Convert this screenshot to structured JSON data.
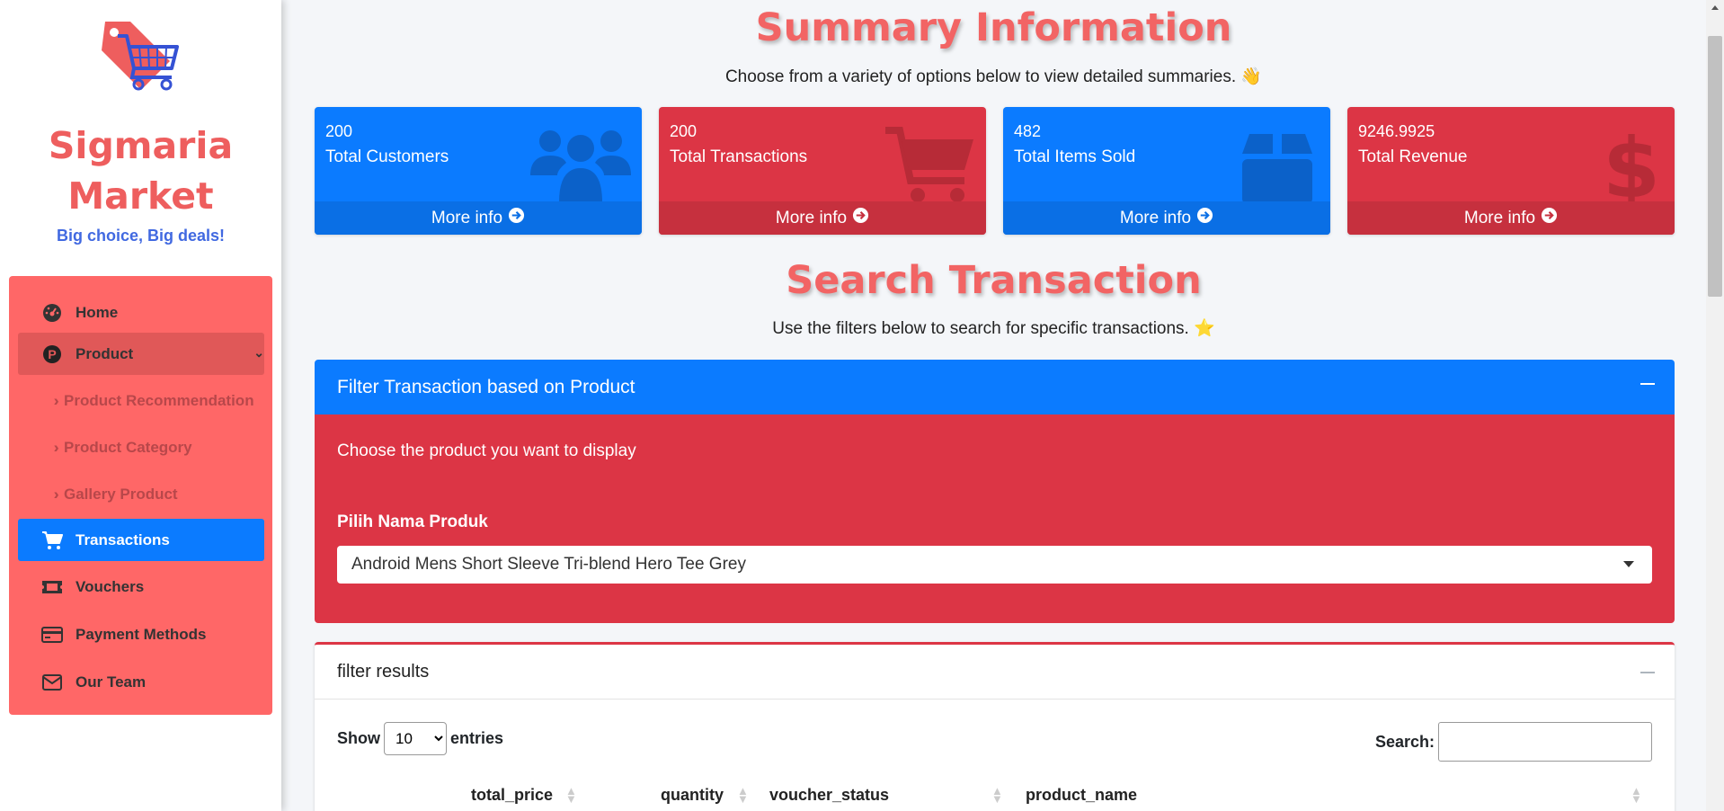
{
  "sidebar": {
    "brand_line1": "Sigmaria",
    "brand_line2": "Market",
    "tagline": "Big choice, Big deals!",
    "items": [
      {
        "label": "Home",
        "icon": "dashboard-icon"
      },
      {
        "label": "Product",
        "icon": "p-circle-icon"
      },
      {
        "label": "Transactions",
        "icon": "cart-icon"
      },
      {
        "label": "Vouchers",
        "icon": "ticket-icon"
      },
      {
        "label": "Payment Methods",
        "icon": "credit-card-icon"
      },
      {
        "label": "Our Team",
        "icon": "envelope-icon"
      }
    ],
    "subitems": [
      {
        "label": "Product Recommendation"
      },
      {
        "label": "Product Category"
      },
      {
        "label": "Gallery Product"
      }
    ],
    "active_item": "Transactions",
    "colors": {
      "panel": "#ff6767",
      "active": "#0b7bff",
      "brand": "#ee5e5e",
      "tagline": "#4169e1"
    }
  },
  "summary": {
    "title": "Summary Information",
    "subtitle": "Choose from a variety of options below to view detailed summaries. 👋",
    "boxes": [
      {
        "value": "200",
        "label": "Total Customers",
        "footer": "More info",
        "icon": "users-icon",
        "color": "#0b7bff"
      },
      {
        "value": "200",
        "label": "Total Transactions",
        "footer": "More info",
        "icon": "cart-icon",
        "color": "#dc3545"
      },
      {
        "value": "482",
        "label": "Total Items Sold",
        "footer": "More info",
        "icon": "box-icon",
        "color": "#0b7bff"
      },
      {
        "value": "9246.9925",
        "label": "Total Revenue",
        "footer": "More info",
        "icon": "dollar-icon",
        "color": "#dc3545"
      }
    ]
  },
  "search": {
    "title": "Search Transaction",
    "subtitle": "Use the filters below to search for specific transactions. ⭐"
  },
  "filter_card": {
    "header": "Filter Transaction based on Product",
    "body_text": "Choose the product you want to display",
    "select_label": "Pilih Nama Produk",
    "selected_value": "Android Mens Short Sleeve Tri-blend Hero Tee Grey"
  },
  "results_card": {
    "header": "filter results",
    "show_label": "Show",
    "entries_value": "10",
    "entries_label": "entries",
    "search_label": "Search:",
    "columns": [
      "total_price",
      "quantity",
      "voucher_status",
      "product_name"
    ]
  }
}
